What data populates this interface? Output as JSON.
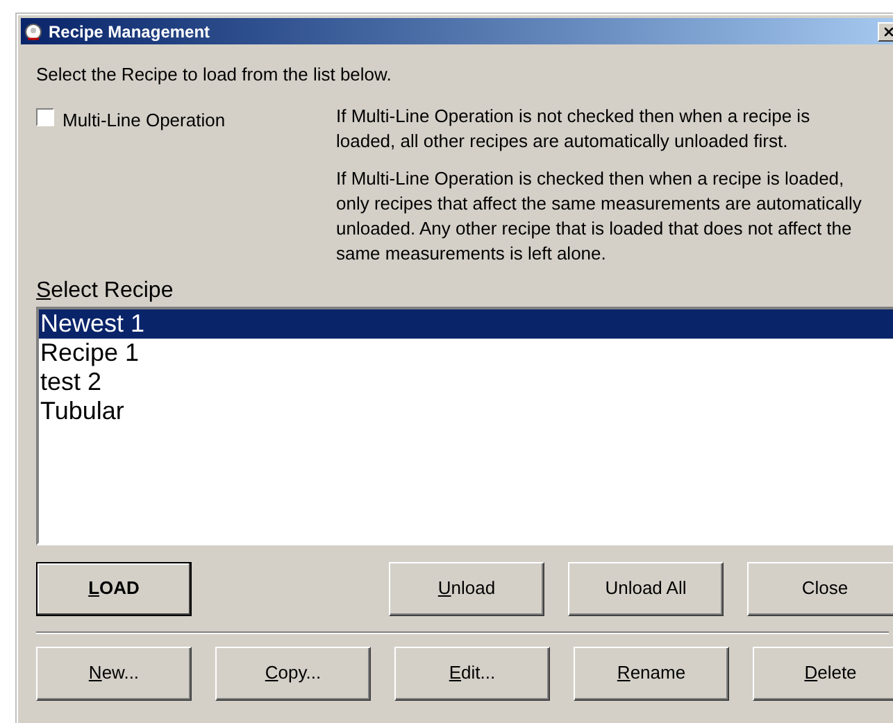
{
  "window": {
    "title": "Recipe Management"
  },
  "instruction": "Select the Recipe to load from the list below.",
  "multi_line": {
    "label": "Multi-Line Operation",
    "checked": false
  },
  "help": [
    "If Multi-Line Operation is not checked then when a recipe is loaded, all other recipes are automatically unloaded first.",
    "If Multi-Line Operation is checked then when a recipe is loaded, only recipes that affect the same measurements are automatically unloaded.  Any other recipe that is loaded that does not affect the same measurements is left alone."
  ],
  "recipe_list": {
    "label": "Select Recipe",
    "mnemonic": true,
    "items": [
      {
        "label": "Newest 1",
        "selected": true
      },
      {
        "label": "Recipe 1",
        "selected": false
      },
      {
        "label": "test 2",
        "selected": false
      },
      {
        "label": "Tubular",
        "selected": false
      }
    ]
  },
  "buttons_top": [
    {
      "label": "LOAD",
      "mnemonic": true,
      "default": true,
      "kind": "button"
    },
    {
      "kind": "spacer"
    },
    {
      "label": "Unload",
      "mnemonic": true,
      "default": false,
      "kind": "button"
    },
    {
      "label": "Unload All",
      "mnemonic": false,
      "default": false,
      "kind": "button"
    },
    {
      "label": "Close",
      "mnemonic": false,
      "default": false,
      "kind": "button"
    }
  ],
  "buttons_bottom": [
    {
      "label": "New...",
      "mnemonic": true,
      "default": false,
      "kind": "button"
    },
    {
      "label": "Copy...",
      "mnemonic": true,
      "default": false,
      "kind": "button"
    },
    {
      "label": "Edit...",
      "mnemonic": true,
      "default": false,
      "kind": "button"
    },
    {
      "label": "Rename",
      "mnemonic": true,
      "default": false,
      "kind": "button"
    },
    {
      "label": "Delete",
      "mnemonic": true,
      "default": false,
      "kind": "button"
    }
  ]
}
